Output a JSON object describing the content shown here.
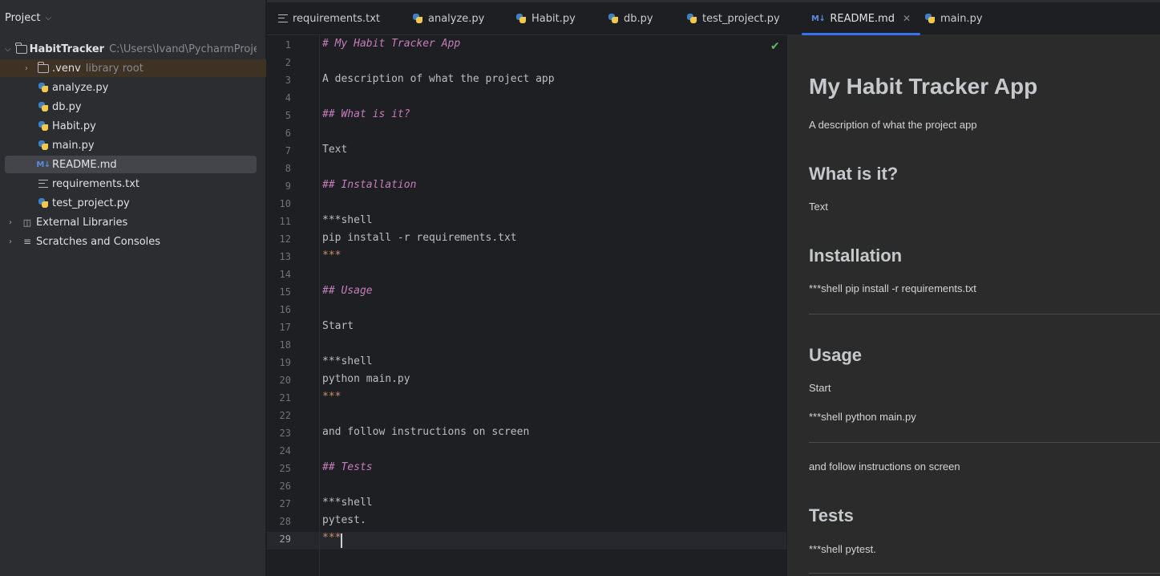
{
  "sidebar": {
    "title": "Project",
    "root": {
      "name": "HabitTracker",
      "path": "C:\\Users\\Ivand\\PycharmProjects"
    },
    "venv": {
      "name": ".venv",
      "note": "library root"
    },
    "files": [
      "analyze.py",
      "db.py",
      "Habit.py",
      "main.py",
      "README.md",
      "requirements.txt",
      "test_project.py"
    ],
    "external_libraries": "External Libraries",
    "scratches": "Scratches and Consoles"
  },
  "tabs": [
    {
      "label": "requirements.txt",
      "icon": "text-file-icon"
    },
    {
      "label": "analyze.py",
      "icon": "python-file-icon"
    },
    {
      "label": "Habit.py",
      "icon": "python-file-icon"
    },
    {
      "label": "db.py",
      "icon": "python-file-icon"
    },
    {
      "label": "test_project.py",
      "icon": "python-file-icon"
    },
    {
      "label": "README.md",
      "icon": "markdown-file-icon",
      "active": true
    },
    {
      "label": "main.py",
      "icon": "python-file-icon"
    }
  ],
  "editor": {
    "current_line": 29,
    "lines": [
      "# My Habit Tracker App",
      "",
      "A description of what the project app",
      "",
      "## What is it?",
      "",
      "Text",
      "",
      "## Installation",
      "",
      "***shell",
      "pip install -r requirements.txt",
      "***",
      "",
      "## Usage",
      "",
      "Start",
      "",
      "***shell",
      "python main.py",
      "***",
      "",
      "and follow instructions on screen",
      "",
      "## Tests",
      "",
      "***shell",
      "pytest.",
      "***"
    ]
  },
  "preview": {
    "title": "My Habit Tracker App",
    "description": "A description of what the project app",
    "what_heading": "What is it?",
    "what_text": "Text",
    "install_heading": "Installation",
    "install_text": "***shell pip install -r requirements.txt",
    "usage_heading": "Usage",
    "usage_start": "Start",
    "usage_shell": "***shell python main.py",
    "follow_text": "and follow instructions on screen",
    "tests_heading": "Tests",
    "tests_text": "***shell pytest."
  },
  "colors": {
    "accent": "#3574f0",
    "markdown_heading": "#c77dbb",
    "markdown_fence": "#cf8e6d",
    "ok_check": "#5fb865"
  }
}
